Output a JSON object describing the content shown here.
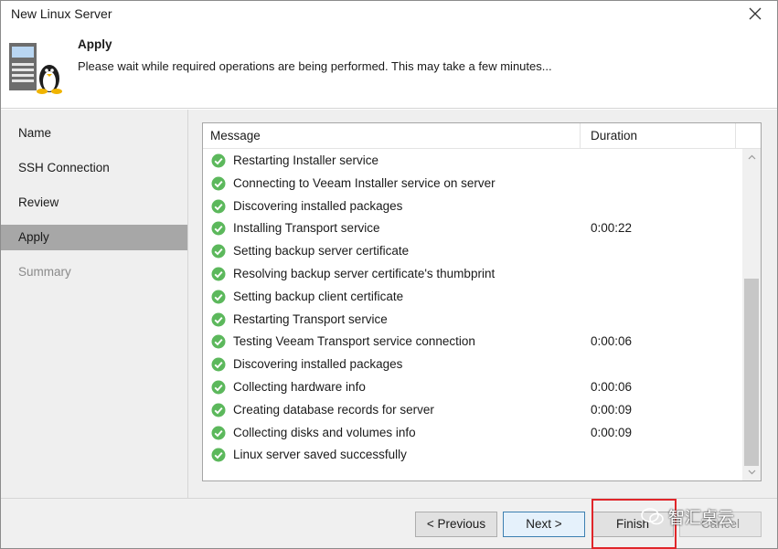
{
  "window": {
    "title": "New Linux Server"
  },
  "header": {
    "title": "Apply",
    "description": "Please wait while required operations are being performed. This may take a few minutes..."
  },
  "nav": {
    "items": [
      {
        "label": "Name",
        "state": "normal"
      },
      {
        "label": "SSH Connection",
        "state": "normal"
      },
      {
        "label": "Review",
        "state": "normal"
      },
      {
        "label": "Apply",
        "state": "active"
      },
      {
        "label": "Summary",
        "state": "disabled"
      }
    ]
  },
  "table": {
    "columns": [
      "Message",
      "Duration"
    ],
    "rows": [
      {
        "message": "Restarting Installer service",
        "duration": ""
      },
      {
        "message": "Connecting to Veeam Installer service on server",
        "duration": ""
      },
      {
        "message": "Discovering installed packages",
        "duration": ""
      },
      {
        "message": "Installing Transport service",
        "duration": "0:00:22"
      },
      {
        "message": "Setting backup server certificate",
        "duration": ""
      },
      {
        "message": "Resolving backup server certificate's thumbprint",
        "duration": ""
      },
      {
        "message": "Setting backup client certificate",
        "duration": ""
      },
      {
        "message": "Restarting Transport service",
        "duration": ""
      },
      {
        "message": "Testing Veeam Transport service connection",
        "duration": "0:00:06"
      },
      {
        "message": "Discovering installed packages",
        "duration": ""
      },
      {
        "message": "Collecting hardware info",
        "duration": "0:00:06"
      },
      {
        "message": "Creating database records for server",
        "duration": "0:00:09"
      },
      {
        "message": "Collecting disks and volumes info",
        "duration": "0:00:09"
      },
      {
        "message": "Linux server saved successfully",
        "duration": ""
      }
    ],
    "status_icon": "success-check-icon",
    "status_color": "#5cb85c"
  },
  "footer": {
    "previous_label": "< Previous",
    "next_label": "Next >",
    "finish_label": "Finish",
    "cancel_label": "Cancel"
  },
  "watermark": {
    "text": "智汇桌云"
  },
  "colors": {
    "highlight": "#e0262a",
    "active_nav": "#a7a7a7",
    "check": "#5cb85c"
  }
}
